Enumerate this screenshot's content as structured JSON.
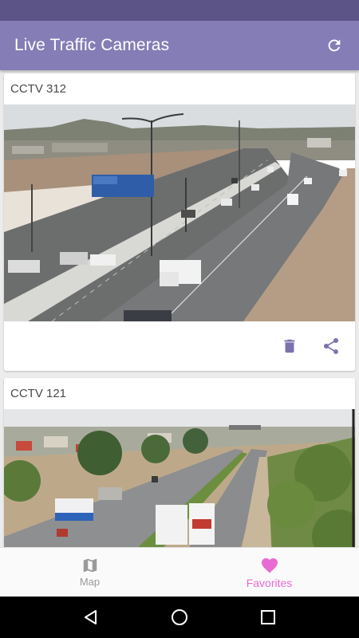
{
  "app_bar": {
    "title": "Live Traffic Cameras",
    "refresh_icon": "refresh-icon"
  },
  "cameras": [
    {
      "name": "CCTV 312",
      "actions": [
        "delete-icon",
        "share-icon"
      ]
    },
    {
      "name": "CCTV 121"
    }
  ],
  "bottom_nav": {
    "map_label": "Map",
    "favorites_label": "Favorites",
    "selected": "favorites"
  },
  "system_nav": [
    "back-icon",
    "home-icon",
    "recents-icon"
  ],
  "colors": {
    "status_bar": "#5c5486",
    "app_bar": "#857db6",
    "action_icon": "#7b73ad",
    "favorites_accent": "#e86bd3",
    "inactive_nav": "#9a9a9a"
  }
}
